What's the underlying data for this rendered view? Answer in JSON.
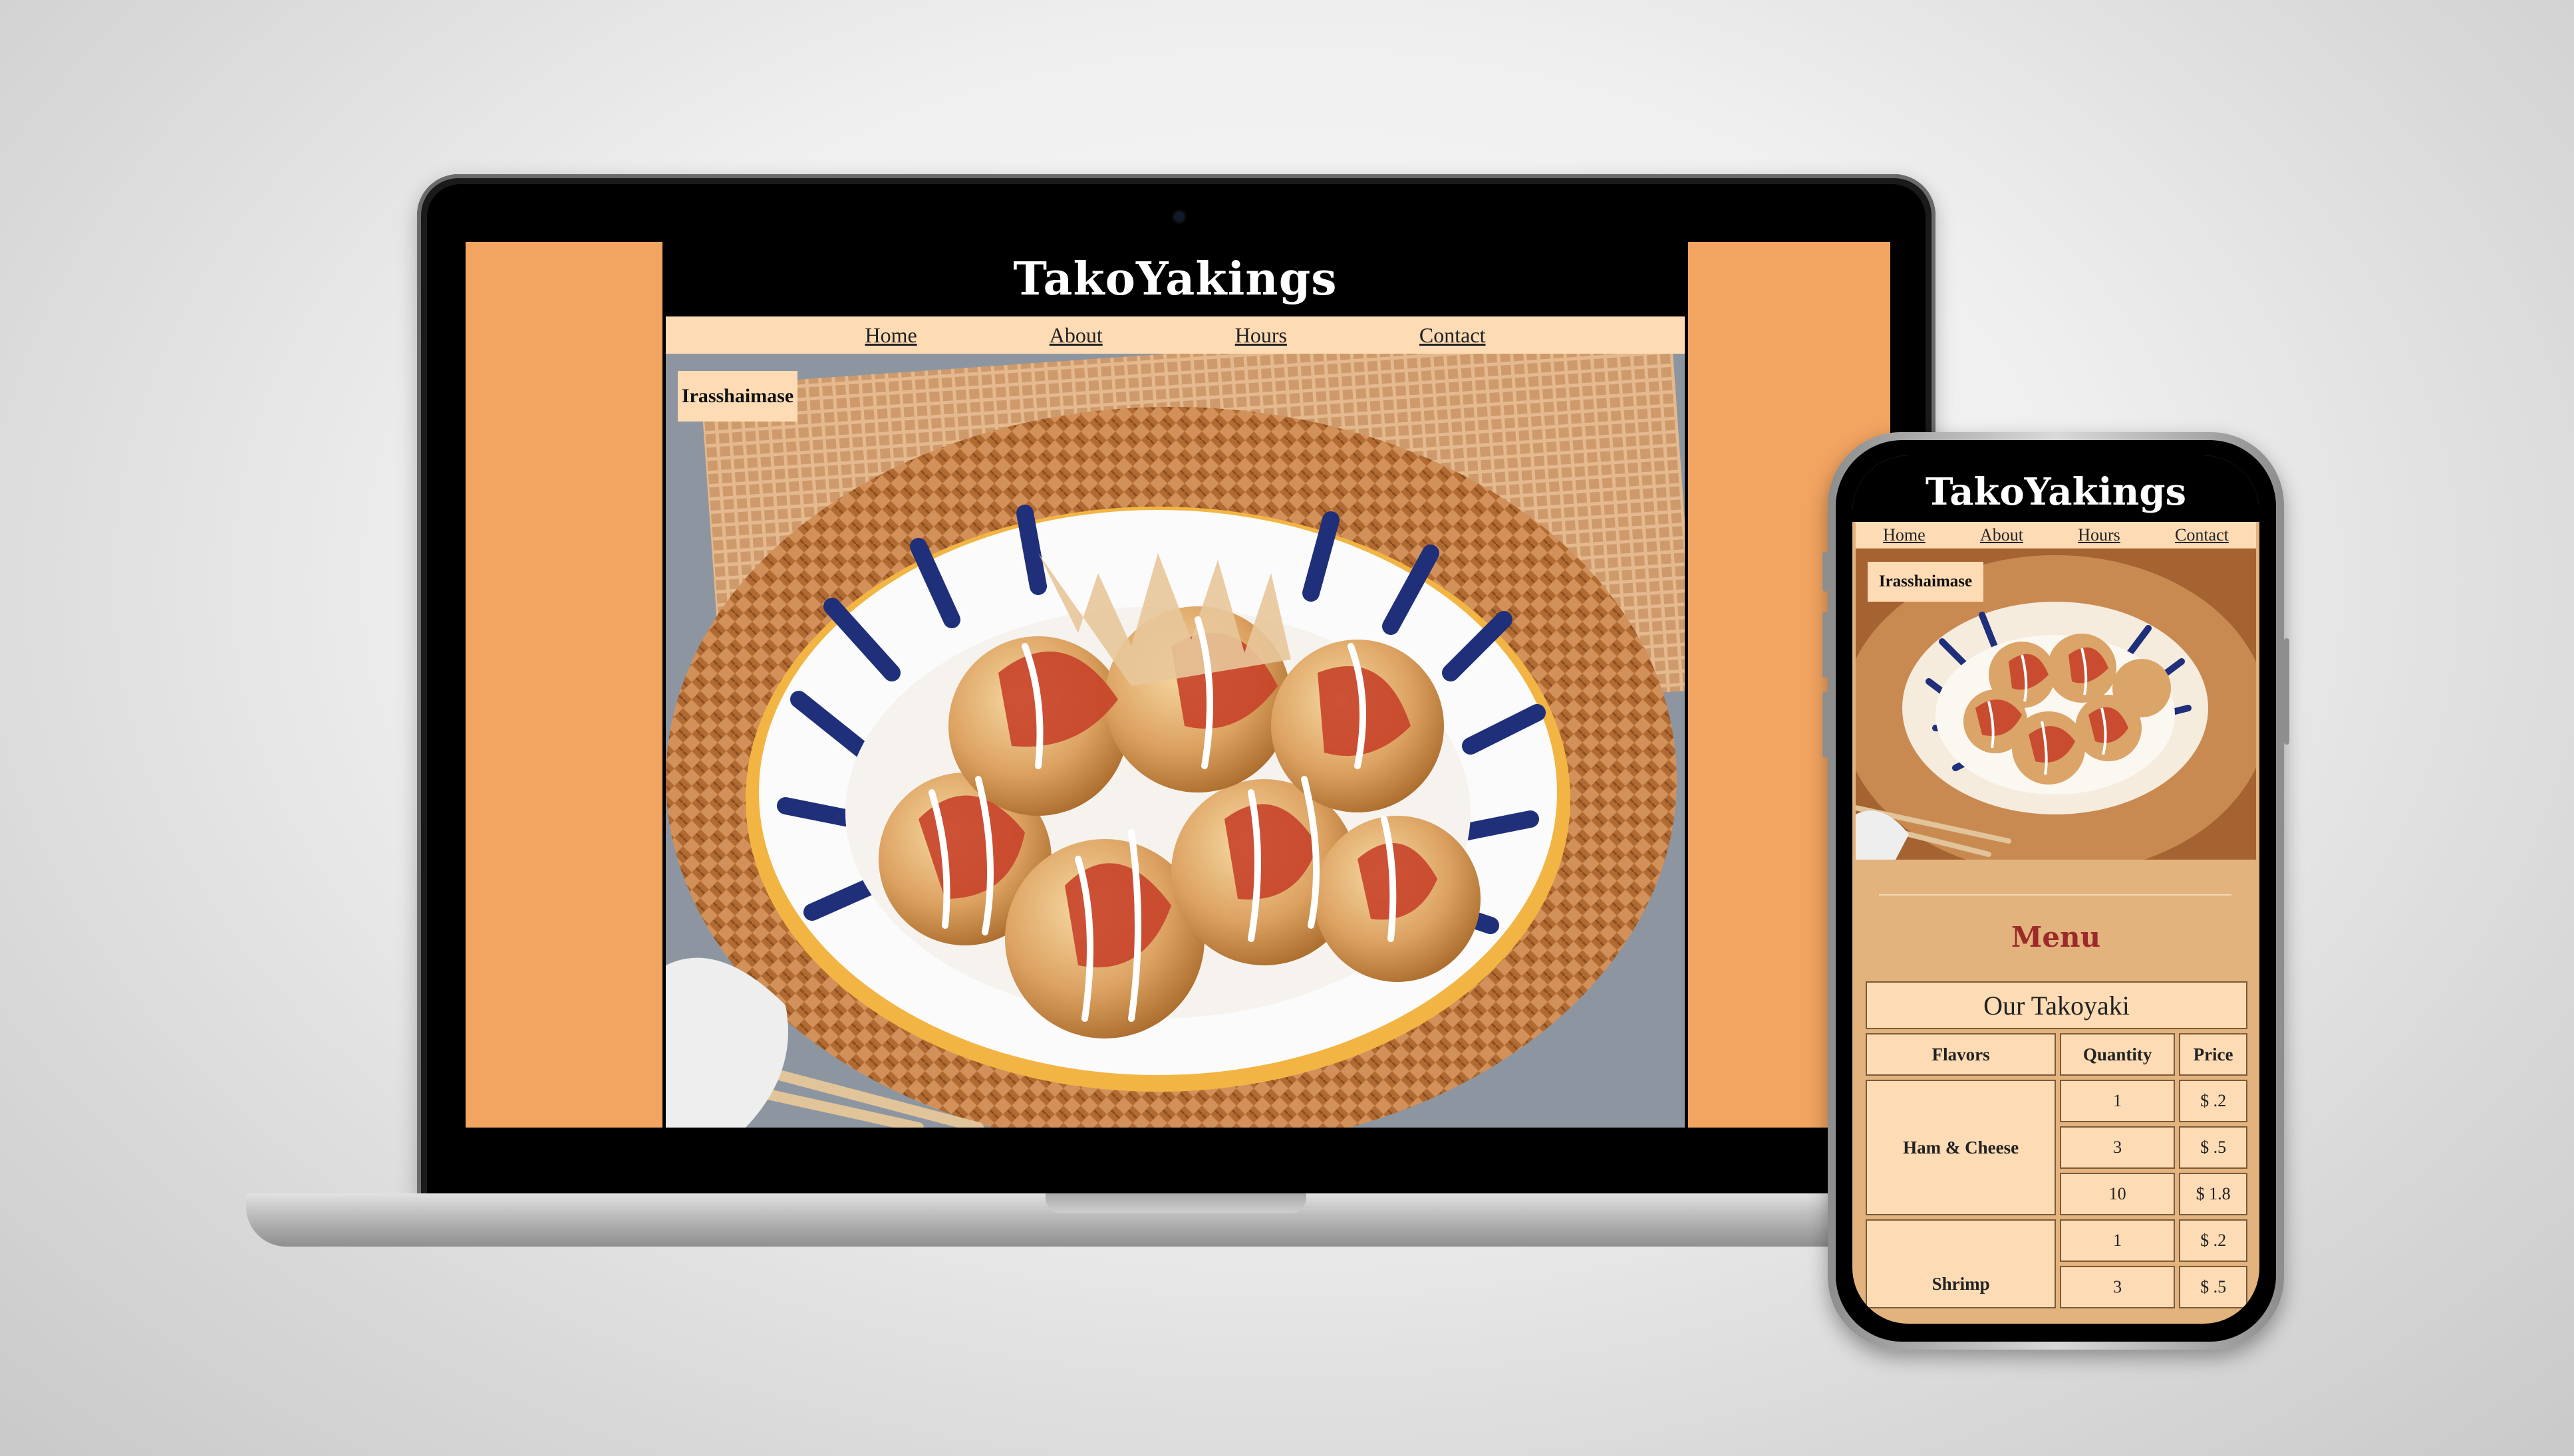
{
  "site": {
    "title": "TakoYakings",
    "nav": [
      "Home",
      "About",
      "Hours",
      "Contact"
    ],
    "greeting": "Irasshaimase"
  },
  "menu": {
    "heading": "Menu",
    "table_caption": "Our Takoyaki",
    "columns": [
      "Flavors",
      "Quantity",
      "Price"
    ],
    "rows": [
      {
        "flavor": "Ham & Cheese",
        "quantity": "1",
        "price": "$ .2"
      },
      {
        "flavor": "",
        "quantity": "3",
        "price": "$ .5"
      },
      {
        "flavor": "",
        "quantity": "10",
        "price": "$ 1.8"
      },
      {
        "flavor": "Shrimp",
        "quantity": "1",
        "price": "$ .2"
      },
      {
        "flavor": "",
        "quantity": "3",
        "price": "$ .5"
      }
    ]
  },
  "colors": {
    "side_background": "#f2a461",
    "nav_background": "#fddbb4",
    "header_background": "#000000",
    "menu_heading": "#9c2a2a",
    "menu_section_background": "#e3b37e"
  },
  "hero_image": "takoyaki-plate-image"
}
